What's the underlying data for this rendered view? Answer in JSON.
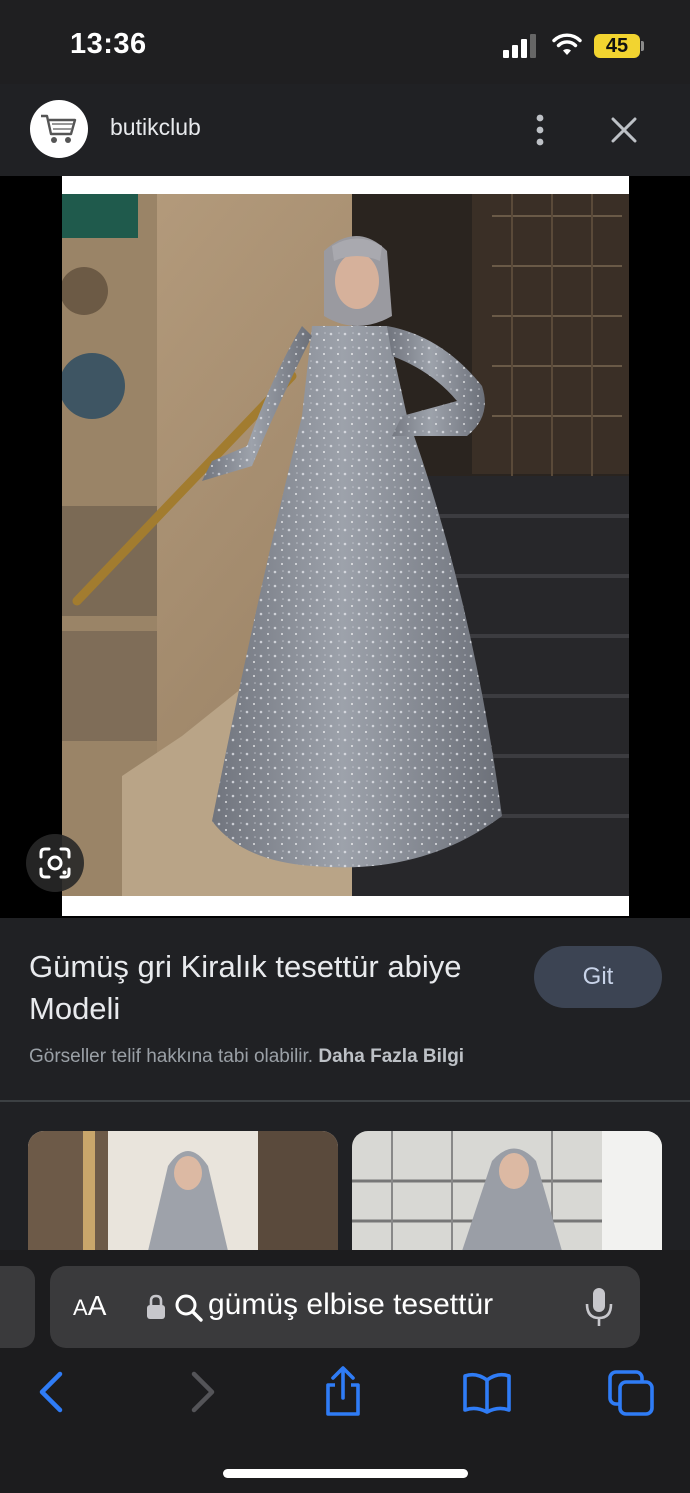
{
  "status_bar": {
    "time": "13:36",
    "battery": "45"
  },
  "header": {
    "site_name": "butikclub",
    "logo_icon": "shopping-cart-icon",
    "more_icon": "more-vert-icon",
    "close_icon": "close-icon"
  },
  "image": {
    "dress_color": "#8d929c",
    "lens_icon": "google-lens-icon"
  },
  "result": {
    "title": "Gümüş gri Kiralık tesettür abiye Modeli",
    "visit_label": "Git",
    "copyright_text": "Görseller telif hakkına tabi olabilir.",
    "learn_more": "Daha Fazla Bilgi"
  },
  "browser": {
    "aa_label_small": "A",
    "aa_label_big": "A",
    "url": "gümüş elbise tesettür",
    "accent": "#2f7cf6"
  }
}
